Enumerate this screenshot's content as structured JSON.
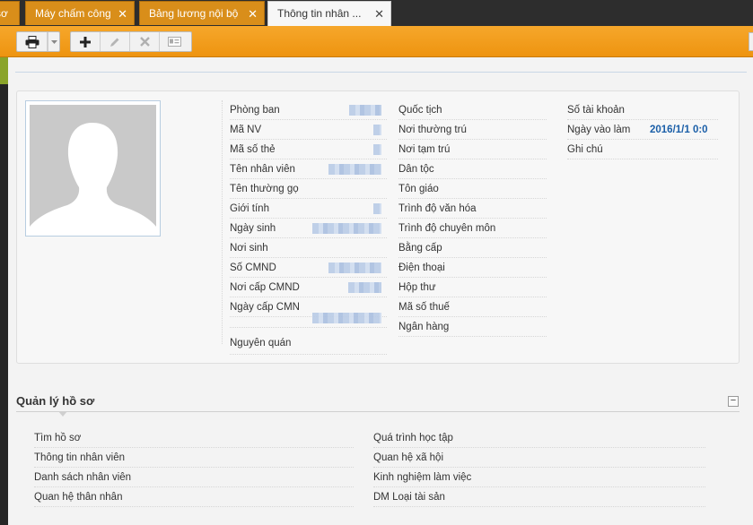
{
  "tabs": [
    {
      "label": "sơ",
      "close": "✕"
    },
    {
      "label": "Máy chấm công",
      "close": "✕"
    },
    {
      "label": "Bảng lương nội bộ",
      "close": "✕"
    },
    {
      "label": "Thông tin nhân ...",
      "close": "✕"
    }
  ],
  "toolbar": {
    "icons": [
      "print-icon",
      "chevron-down-icon",
      "plus-icon",
      "pencil-icon",
      "delete-icon",
      "card-icon"
    ]
  },
  "profile": {
    "col1": [
      {
        "label": "Phòng ban"
      },
      {
        "label": "Mã NV"
      },
      {
        "label": "Mã số thẻ"
      },
      {
        "label": "Tên nhân viên"
      },
      {
        "label": "Tên thường gọ"
      },
      {
        "label": "Giới tính"
      },
      {
        "label": "Ngày sinh"
      },
      {
        "label": "Nơi sinh"
      },
      {
        "label": "Số CMND"
      },
      {
        "label": "Nơi cấp CMND"
      },
      {
        "label": "Ngày cấp CMN"
      },
      {
        "label": ""
      },
      {
        "label": "Nguyên quán"
      }
    ],
    "col2": [
      {
        "label": "Quốc tịch"
      },
      {
        "label": "Nơi thường trú"
      },
      {
        "label": "Nơi tạm trú"
      },
      {
        "label": "Dân tộc"
      },
      {
        "label": "Tôn giáo"
      },
      {
        "label": "Trình độ văn hóa"
      },
      {
        "label": "Trình độ chuyên môn"
      },
      {
        "label": "Bằng cấp"
      },
      {
        "label": "Điện thoại"
      },
      {
        "label": "Hộp thư"
      },
      {
        "label": "Mã số thuế"
      },
      {
        "label": "Ngân hàng"
      }
    ],
    "col3": [
      {
        "label": "Số tài khoản",
        "value": ""
      },
      {
        "label": "Ngày vào làm",
        "value": "2016/1/1 0:0"
      },
      {
        "label": "Ghi chú",
        "value": ""
      }
    ]
  },
  "section": {
    "title": "Quản lý hồ sơ",
    "collapse": "−",
    "left_links": [
      "Tìm hồ sơ",
      "Thông tin nhân viên",
      "Danh sách nhân viên",
      "Quan hệ thân nhân"
    ],
    "right_links": [
      "Quá trình học tập",
      "Quan hệ xã hội",
      "Kinh nghiệm làm việc",
      "DM Loại tài sản"
    ]
  },
  "colors": {
    "accent": "#ee9410",
    "value_blue": "#1b5fa8"
  }
}
